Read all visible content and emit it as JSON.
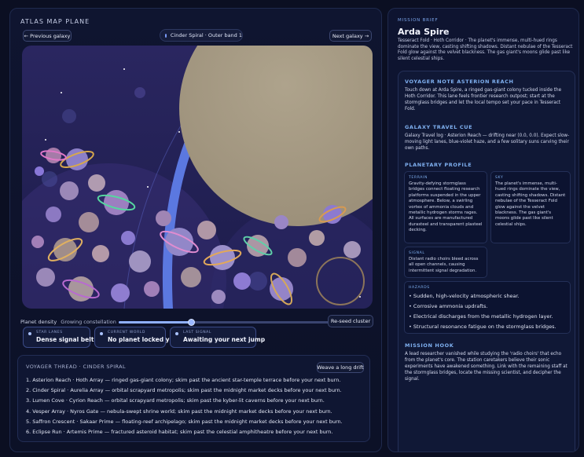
{
  "atlas": {
    "title": "ATLAS MAP PLANE",
    "prev_label": "← Previous galaxy",
    "next_label": "Next galaxy →",
    "sector_chip": "Cinder Spiral · Outer band 1"
  },
  "density": {
    "label": "Planet density",
    "value_label": "Growing constellation",
    "level": 0.34,
    "reseed_label": "Re-seed cluster"
  },
  "stats": [
    {
      "label": "STAR LANES",
      "value": "Dense signal belt"
    },
    {
      "label": "CURRENT WORLD",
      "value": "No planet locked yet"
    },
    {
      "label": "LAST SIGNAL",
      "value": "Awaiting your next jump"
    }
  ],
  "thread": {
    "title": "VOYAGER THREAD · CINDER SPIRAL",
    "weave_label": "Weave a long drift",
    "items": [
      "1. Asterion Reach · Hoth Array — ringed gas-giant colony; skim past the ancient star-temple terrace before your next burn.",
      "2. Cinder Spiral · Aurelia Array — orbital scrapyard metropolis; skim past the midnight market decks before your next burn.",
      "3. Lumen Cove · Cyrion Reach — orbital scrapyard metropolis; skim past the kyber-lit caverns before your next burn.",
      "4. Vesper Array · Nyros Gate — nebula-swept shrine world; skim past the midnight market decks before your next burn.",
      "5. Saffron Crescent · Sakaar Prime — floating-reef archipelago; skim past the midnight market decks before your next burn.",
      "6. Eclipse Run · Artemis Prime — fractured asteroid habitat; skim past the celestial amphitheatre before your next burn."
    ]
  },
  "brief": {
    "kicker": "MISSION BRIEF",
    "title": "Arda Spire",
    "subtitle": "Tesseract Fold · Hoth Corridor · The planet's immense, multi-hued rings dominate the view, casting shifting shadows. Distant nebulae of the Tesseract Fold glow against the velvet blackness. The gas giant's moons glide past like silent celestial ships.",
    "voyager_note_h": "VOYAGER NOTE ASTERION REACH",
    "voyager_note": "Touch down at Arda Spire, a ringed gas-giant colony tucked inside the Hoth Corridor. This lane feels frontier research outpost; start at the stormglass bridges and let the local tempo set your pace in Tesseract Fold.",
    "travel_cue_h": "GALAXY TRAVEL CUE",
    "travel_cue": "Galaxy Travel log · Asterion Reach — drifting near (0.0, 0.0). Expect slow-moving light lanes, blue-violet haze, and a few solitary suns carving their own paths.",
    "profile_h": "PLANETARY PROFILE",
    "terrain_h": "TERRAIN",
    "terrain": "Gravity-defying stormglass bridges connect floating research platforms suspended in the upper atmosphere. Below, a swirling vortex of ammonia clouds and metallic hydrogen storms rages. All surfaces are manufactured durasteel and transparent plasteel decking.",
    "sky_h": "SKY",
    "sky": "The planet's immense, multi-hued rings dominate the view, casting shifting shadows. Distant nebulae of the Tesseract Fold glow against the velvet blackness. The gas giant's moons glide past like silent celestial ships.",
    "signal_h": "SIGNAL",
    "signal": "Distant radio choirs bleed across all open channels, causing intermittent signal degradation.",
    "hazards_h": "HAZARDS",
    "hazards": [
      "Sudden, high-velocity atmospheric shear.",
      "Corrosive ammonia updrafts.",
      "Electrical discharges from the metallic hydrogen layer.",
      "Structural resonance fatigue on the stormglass bridges."
    ],
    "hook_h": "MISSION HOOK",
    "hook": "A lead researcher vanished while studying the 'radio choirs' that echo from the planet's core. The station caretakers believe their sonic experiments have awakened something. Link with the remaining staff at the stormglass bridges, locate the missing scientist, and decipher the signal."
  },
  "colors": {
    "accent": "#7fb0f0",
    "planet_tan": "#a59a84",
    "ring_blue": "#5b78e0"
  }
}
